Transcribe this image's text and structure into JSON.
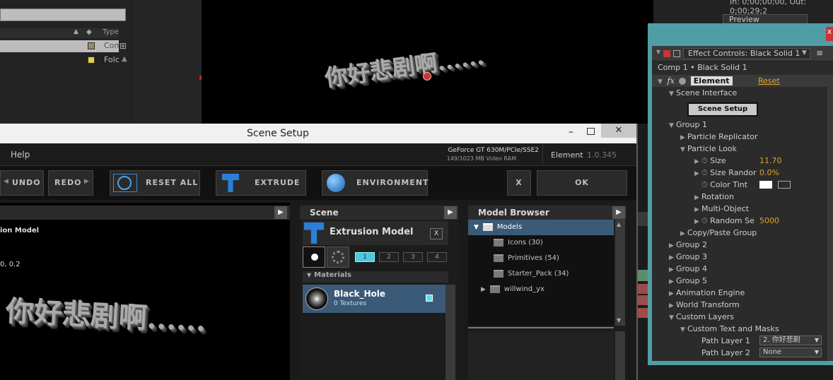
{
  "ae": {
    "project": {
      "col_type": "Type",
      "rows": [
        {
          "type": "Com"
        },
        {
          "type": "Folc"
        }
      ]
    },
    "timecode": "In: 0;00;00;00, Out: 0;00;29;2",
    "preview_tab": "Preview",
    "comp_text": "你好悲剧啊......"
  },
  "effect_controls": {
    "tab": "Effect Controls: Black Solid 1",
    "breadcrumb": "Comp 1 • Black Solid 1",
    "fx": "fx",
    "effect_name": "Element",
    "reset": "Reset",
    "scene_interface": "Scene Interface",
    "scene_setup_btn": "Scene Setup",
    "group1": "Group 1",
    "particle_replicator": "Particle Replicator",
    "particle_look": "Particle Look",
    "size_label": "Size",
    "size_value": "11.70",
    "size_random_label": "Size Randor",
    "size_random_value": "0.0%",
    "color_tint": "Color Tint",
    "rotation": "Rotation",
    "multi_object": "Multi-Object",
    "random_seed_label": "Random Se",
    "random_seed_value": "5000",
    "copy_paste_group": "Copy/Paste Group",
    "group2": "Group 2",
    "group3": "Group 3",
    "group4": "Group 4",
    "group5": "Group 5",
    "animation_engine": "Animation Engine",
    "world_transform": "World Transform",
    "custom_layers": "Custom Layers",
    "custom_text_masks": "Custom Text and Masks",
    "path_layer1_label": "Path Layer 1",
    "path_layer1_value": "2. 你好悲剧",
    "path_layer2_label": "Path Layer 2",
    "path_layer2_value": "None"
  },
  "scene_setup": {
    "title": "Scene Setup",
    "help": "Help",
    "gpu_line1": "GeForce GT 630M/PCIe/SSE2",
    "gpu_line2": "149/1023 MB Video RAM",
    "product": "Element",
    "version": "1.0.345",
    "toolbar": {
      "undo": "UNDO",
      "redo": "REDO",
      "reset_all": "RESET ALL",
      "extrude": "EXTRUDE",
      "environment": "ENVIRONMENT",
      "x": "X",
      "ok": "OK"
    },
    "preview": {
      "label1": "ion Model",
      "label2": "0, 0.2",
      "text": "你好悲剧啊......"
    },
    "scene": {
      "header": "Scene",
      "model_name": "Extrusion Model",
      "group_tabs": [
        "1",
        "2",
        "3",
        "4"
      ],
      "materials_header": "Materials",
      "material_name": "Black_Hole",
      "material_sub": "0 Textures"
    },
    "model_browser": {
      "header": "Model Browser",
      "root": "Models",
      "items": [
        {
          "label": "Icons (30)"
        },
        {
          "label": "Primitives (54)"
        },
        {
          "label": "Starter_Pack (34)"
        },
        {
          "label": "willwind_yx"
        }
      ]
    }
  }
}
